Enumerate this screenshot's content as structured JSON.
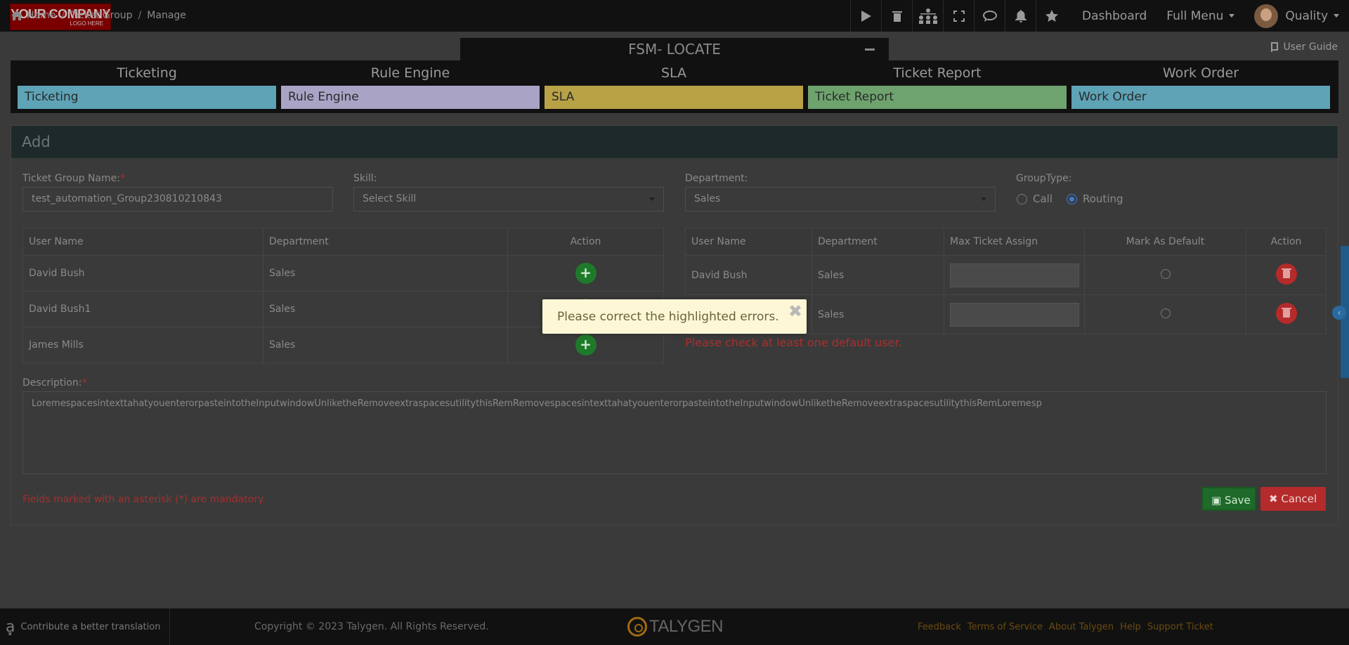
{
  "header": {
    "logo": {
      "line1": "YOUR COMPANY",
      "line2": "LOGO HERE"
    },
    "icons": [
      "play-icon",
      "trash-icon",
      "org-chart-icon",
      "fullscreen-icon",
      "chat-icon",
      "bell-icon",
      "star-icon"
    ],
    "nav": {
      "dashboard": "Dashboard",
      "full_menu": "Full Menu",
      "user": "Quality"
    }
  },
  "breadcrumb": {
    "home": "Home",
    "group": "Ticket Group",
    "current": "Manage"
  },
  "page_title": "FSM- LOCATE",
  "user_guide": "User Guide",
  "modules": [
    {
      "title": "Ticketing",
      "label": "Ticketing",
      "color": "#5ea3b6"
    },
    {
      "title": "Rule Engine",
      "label": "Rule Engine",
      "color": "#a9a4c6"
    },
    {
      "title": "SLA",
      "label": "SLA",
      "color": "#b9a246"
    },
    {
      "title": "Ticket Report",
      "label": "Ticket Report",
      "color": "#6ea36e"
    },
    {
      "title": "Work Order",
      "label": "Work Order",
      "color": "#5ea3b6"
    }
  ],
  "panel": {
    "title": "Add"
  },
  "form": {
    "group_name_label": "Ticket Group Name:",
    "req": "*",
    "group_name_value": "test_automation_Group230810210843",
    "skill_label": "Skill:",
    "skill_value": "Select Skill",
    "department_label": "Department:",
    "department_value": "Sales",
    "group_type_label": "GroupType:",
    "group_type_options": {
      "call": "Call",
      "routing": "Routing"
    },
    "group_type_selected": "Routing",
    "description_label": "Description:",
    "description_value": "LoremespacesintexttahatyouenterorpasteintotheInputwindowUnliketheRemoveextraspacesutilitythisRemRemovespacesintexttahatyouenterorpasteintotheInputwindowUnliketheRemoveextraspacesutilitythisRemLoremesp",
    "mandatory_note": "Fields marked with an asterisk (*) are mandatory.",
    "save": "Save",
    "cancel": "Cancel"
  },
  "left_table": {
    "headers": [
      "User Name",
      "Department",
      "Action"
    ],
    "rows": [
      {
        "name": "David Bush",
        "dept": "Sales"
      },
      {
        "name": "David Bush1",
        "dept": "Sales"
      },
      {
        "name": "James Mills",
        "dept": "Sales"
      }
    ]
  },
  "right_table": {
    "headers": [
      "User Name",
      "Department",
      "Max Ticket Assign",
      "Mark As Default",
      "Action"
    ],
    "rows": [
      {
        "name": "David Bush",
        "dept": "Sales"
      },
      {
        "name": "",
        "dept": "Sales"
      }
    ],
    "error": "Please check at least one default user."
  },
  "toast": {
    "message": "Please correct the highlighted errors."
  },
  "footer": {
    "contribute": "Contribute a better translation",
    "copyright": "Copyright © 2023 Talygen. All Rights Reserved.",
    "brand": "TALYGEN",
    "links": [
      "Feedback",
      "Terms of Service",
      "About Talygen",
      "Help",
      "Support Ticket"
    ]
  }
}
